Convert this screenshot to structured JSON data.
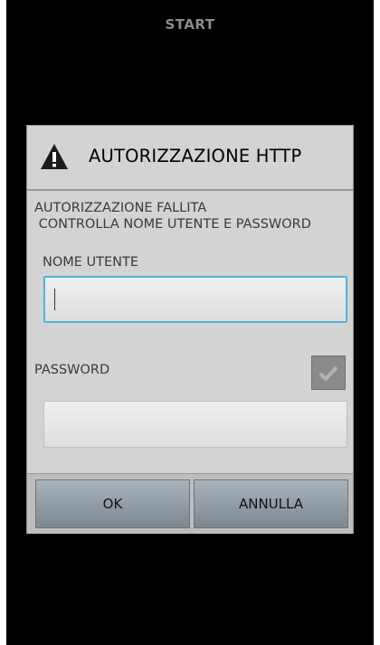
{
  "header": {
    "title": "START"
  },
  "dialog": {
    "title": "AUTORIZZAZIONE HTTP",
    "icon": "warning-icon",
    "message_line1": "AUTORIZZAZIONE FALLITA",
    "message_line2": " CONTROLLA NOME UTENTE E PASSWORD",
    "username_label": "NOME UTENTE",
    "username_value": "",
    "password_label": "PASSWORD",
    "password_value": "",
    "show_password_checked": true,
    "ok_label": "OK",
    "cancel_label": "ANNULLA"
  },
  "colors": {
    "background": "#000000",
    "dialog": "#d3d3d3",
    "focus_border": "#4fb3d8",
    "button": "#8f99a2"
  }
}
